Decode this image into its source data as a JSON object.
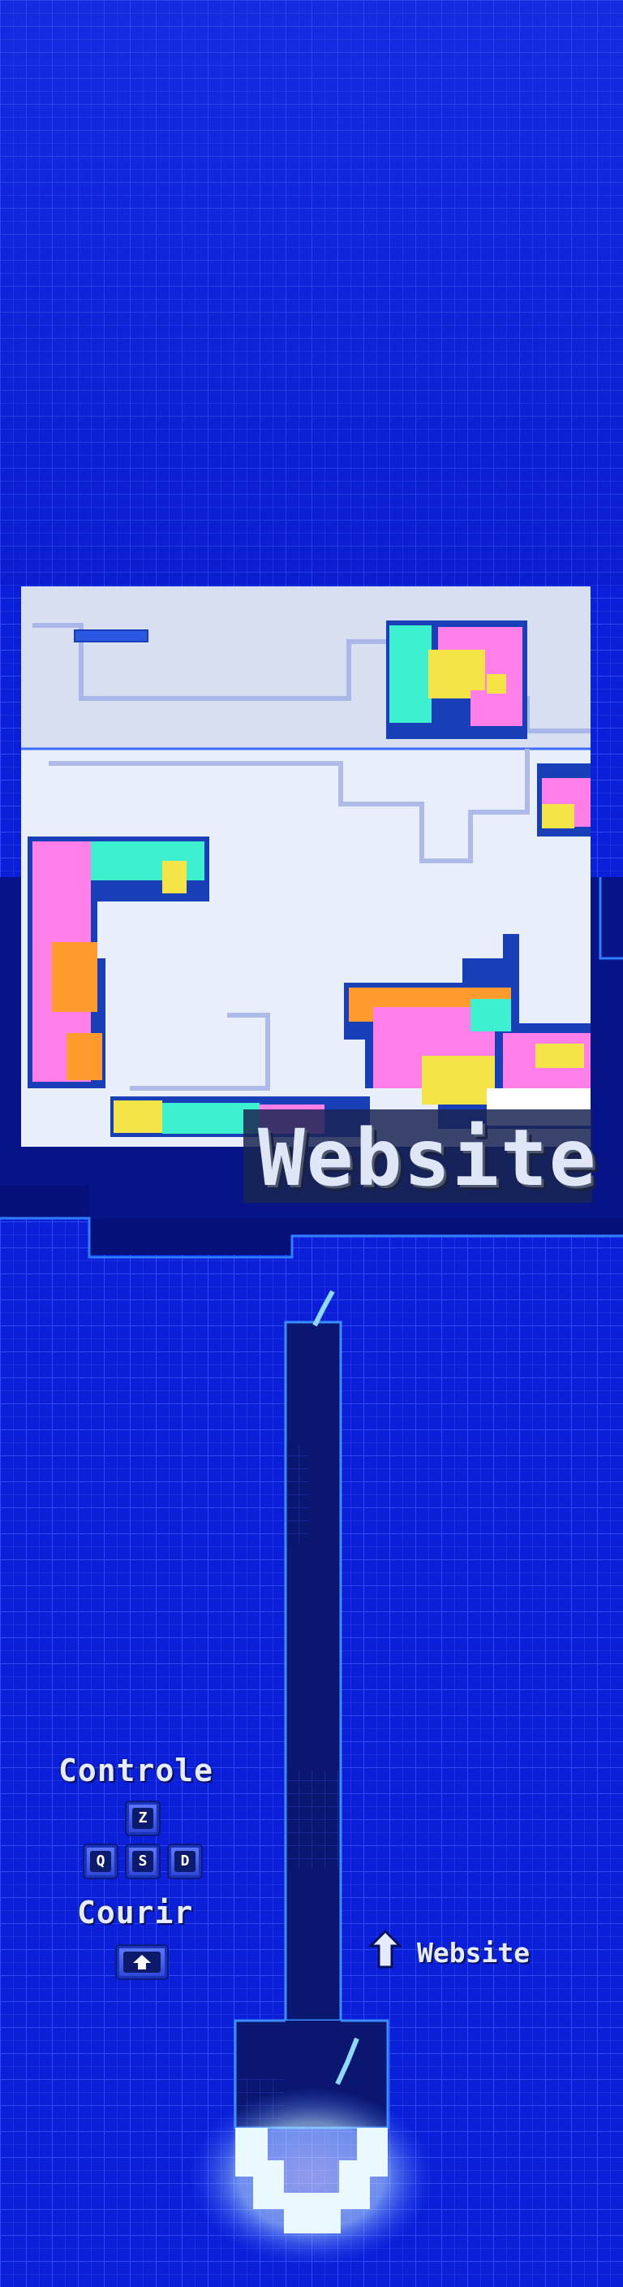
{
  "scene": {
    "colors": {
      "background": "#0b1fd8",
      "grid_line": "#3150ff",
      "dark_band": "#051078",
      "corridor": "#0a1670",
      "map_white": "#eef1fb",
      "map_pink": "#ff7ee8",
      "map_cyan": "#3cf0d0",
      "map_yellow": "#f5e447",
      "map_orange": "#ff9a2c",
      "glow": "#d8f4ff"
    }
  },
  "overlay": {
    "title": "Website"
  },
  "hud": {
    "controls_label": "Controle",
    "keys": [
      "Z",
      "Q",
      "S",
      "D"
    ],
    "run_label": "Courir",
    "run_key_icon": "shift-arrow-icon"
  },
  "portal": {
    "label": "Website",
    "icon": "up-arrow-icon"
  }
}
